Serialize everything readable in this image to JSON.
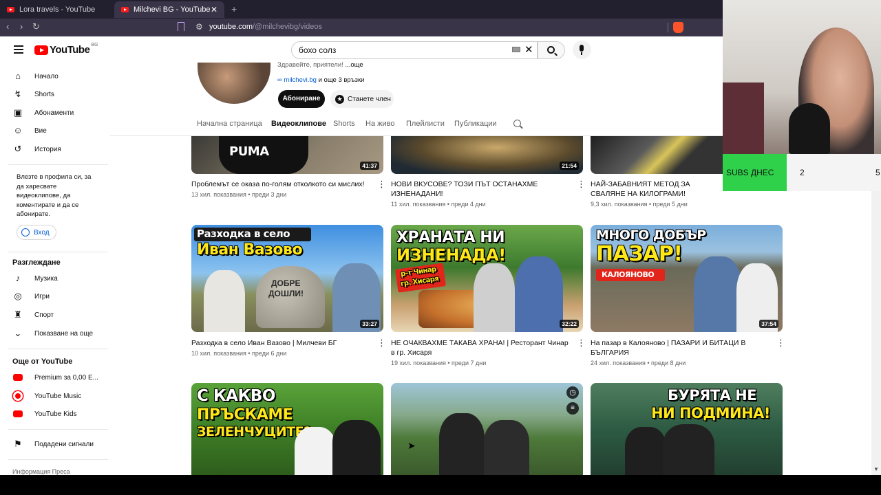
{
  "browser": {
    "tabs": [
      {
        "title": "Lora travels - YouTube"
      },
      {
        "title": "Milchevi BG - YouTube"
      }
    ],
    "url_host": "youtube.com",
    "url_path": "/@milchevibg/videos"
  },
  "header": {
    "logo_text": "YouTube",
    "logo_country": "BG",
    "search_value": "бохо солз"
  },
  "sidebar": {
    "primary": [
      {
        "label": "Начало",
        "icon": "home-icon"
      },
      {
        "label": "Shorts",
        "icon": "shorts-icon"
      },
      {
        "label": "Абонаменти",
        "icon": "subscriptions-icon"
      },
      {
        "label": "Вие",
        "icon": "user-icon"
      },
      {
        "label": "История",
        "icon": "history-icon"
      }
    ],
    "signin_prompt": "Влезте в профила си, за да харесвате видеоклипове, да коментирате и да се абонирате.",
    "signin_label": "Вход",
    "explore_heading": "Разглеждане",
    "explore": [
      {
        "label": "Музика",
        "icon": "music-icon"
      },
      {
        "label": "Игри",
        "icon": "gaming-icon"
      },
      {
        "label": "Спорт",
        "icon": "trophy-icon"
      },
      {
        "label": "Показване на още",
        "icon": "chevron-down-icon"
      }
    ],
    "more_heading": "Още от YouTube",
    "more": [
      {
        "label": "Premium за 0,00 Е..."
      },
      {
        "label": "YouTube Music"
      },
      {
        "label": "YouTube Kids"
      }
    ],
    "report_label": "Подадени сигнали",
    "footer": "Информация  Преса"
  },
  "channel": {
    "greeting": "Здравейте, приятели! ",
    "greeting_more": "...още",
    "link_text": "milchevi.bg",
    "link_more": " и още 3 връзки",
    "subscribe_label": "Абониране",
    "join_label": "Станете член",
    "tabs": [
      "Начална страница",
      "Видеоклипове",
      "Shorts",
      "На живо",
      "Плейлисти",
      "Публикации"
    ]
  },
  "videos": [
    {
      "title": "Проблемът се оказа по-голям отколкото си мислих!",
      "meta": "13 хил. показвания • преди 3 дни",
      "duration": "41:37",
      "overlay": "PUMA"
    },
    {
      "title": "НОВИ ВКУСОВЕ? ТОЗИ ПЪТ ОСТАНАХМЕ ИЗНЕНАДАНИ!",
      "meta": "11 хил. показвания • преди 4 дни",
      "duration": "21:54",
      "overlay": ""
    },
    {
      "title": "НАЙ-ЗАБАВНИЯТ МЕТОД ЗА СВАЛЯНЕ НА КИЛОГРАМИ!",
      "meta": "9,3 хил. показвания • преди 5 дни",
      "duration": "",
      "overlay": ""
    },
    {
      "title": "Разходка в село Иван Вазово | Милчеви БГ",
      "meta": "10 хил. показвания • преди 6 дни",
      "duration": "33:27",
      "overlay1": "Разходка в село",
      "overlay2": "Иван Вазово",
      "sign1": "ДОБРЕ",
      "sign2": "ДОШЛИ!"
    },
    {
      "title": "НЕ ОЧАКВАХМЕ ТАКАВА ХРАНА! | Ресторант Чинар в гр. Хисаря",
      "meta": "19 хил. показвания • преди 7 дни",
      "duration": "32:22",
      "overlay1": "ХРАНАТА НИ",
      "overlay2": "ИЗНЕНАДА!",
      "badge1": "р-т Чинар",
      "badge2": "гр. Хисаря"
    },
    {
      "title": "На пазар в Калояново | ПАЗАРИ И БИТАЦИ В БЪЛГАРИЯ",
      "meta": "24 хил. показвания • преди 8 дни",
      "duration": "37:54",
      "overlay1": "МНОГО ДОБЪР",
      "overlay2": "ПАЗАР!",
      "badge1": "КАЛОЯНОВО"
    },
    {
      "title": "",
      "meta": "",
      "duration": "",
      "overlay1": "С КАКВО",
      "overlay2": "ПРЪСКАМЕ",
      "overlay3": "ЗЕЛЕНЧУЦИТЕ?"
    },
    {
      "title": "",
      "meta": "",
      "duration": ""
    },
    {
      "title": "",
      "meta": "",
      "duration": "",
      "overlay1": "БУРЯТА НЕ",
      "overlay2": "НИ ПОДМИНА!"
    }
  ],
  "stream_overlay": {
    "subs_label": "SUBS ДНЕС",
    "value_a": "2",
    "value_b": "5"
  },
  "colors": {
    "accent_red": "#ff0000",
    "link_blue": "#065fd4",
    "subs_green": "#2fd14a"
  }
}
